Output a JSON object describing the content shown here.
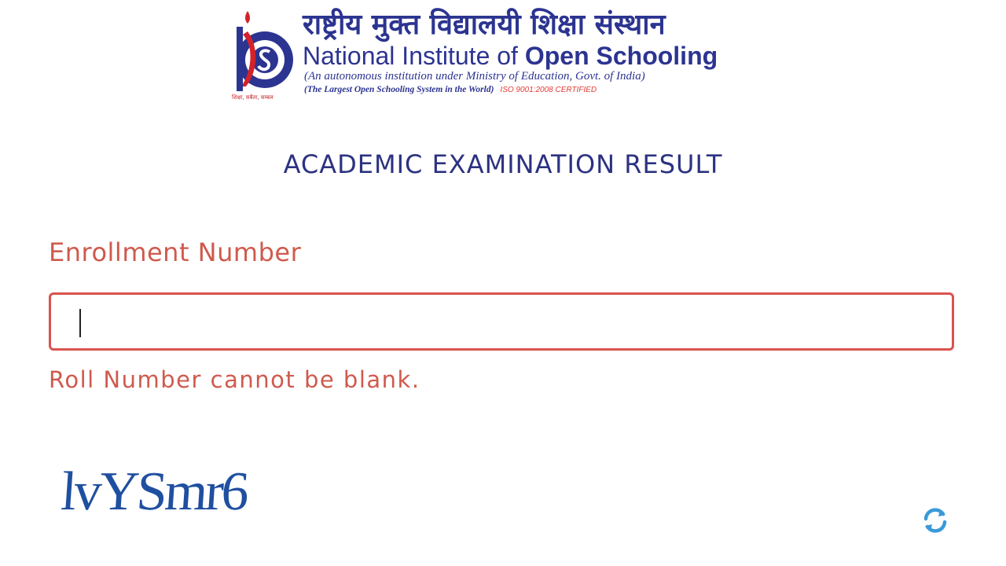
{
  "logo": {
    "hindi_name": "राष्ट्रीय मुक्त विद्यालयी शिक्षा संस्थान",
    "english_name_part1": "National Institute of ",
    "english_name_part2": "Open Schooling",
    "tagline": "(An autonomous institution under Ministry of Education, Govt. of India)",
    "tagline2": "(The Largest Open Schooling System in the World)",
    "certification": "ISO 9001:2008 CERTIFIED",
    "emblem_caption": "शिक्षा, सबैता, सम्बल",
    "emblem_icon": "nios-emblem-icon"
  },
  "page": {
    "title": "ACADEMIC EXAMINATION RESULT"
  },
  "form": {
    "enrollment_label": "Enrollment Number",
    "enrollment_value": "",
    "error_message": "Roll Number cannot be blank."
  },
  "captcha": {
    "text": "lvYSmr6",
    "refresh_icon": "refresh-icon"
  },
  "colors": {
    "brand_blue": "#2c3491",
    "error_red": "#d9534f",
    "label_red": "#cf5a4d",
    "refresh_blue": "#3a9ad9"
  }
}
